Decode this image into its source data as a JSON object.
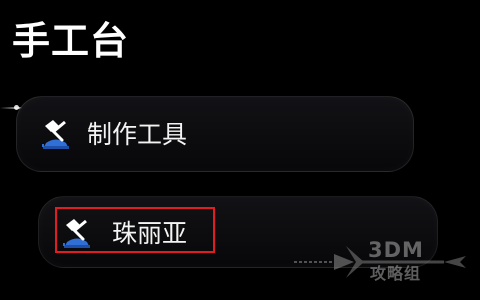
{
  "screen": {
    "title": "手工台",
    "colors": {
      "background": "#000000",
      "text": "#ffffff",
      "highlight": "#e11d22",
      "icon_blue": "#2f6fd6"
    }
  },
  "menu": {
    "items": [
      {
        "label": "制作工具",
        "icon": "crafting-hammer-icon"
      },
      {
        "label": "珠丽亚",
        "icon": "crafting-hammer-icon",
        "highlighted": true
      }
    ]
  },
  "watermark": {
    "line1": "3DM",
    "line2": "攻略组"
  }
}
